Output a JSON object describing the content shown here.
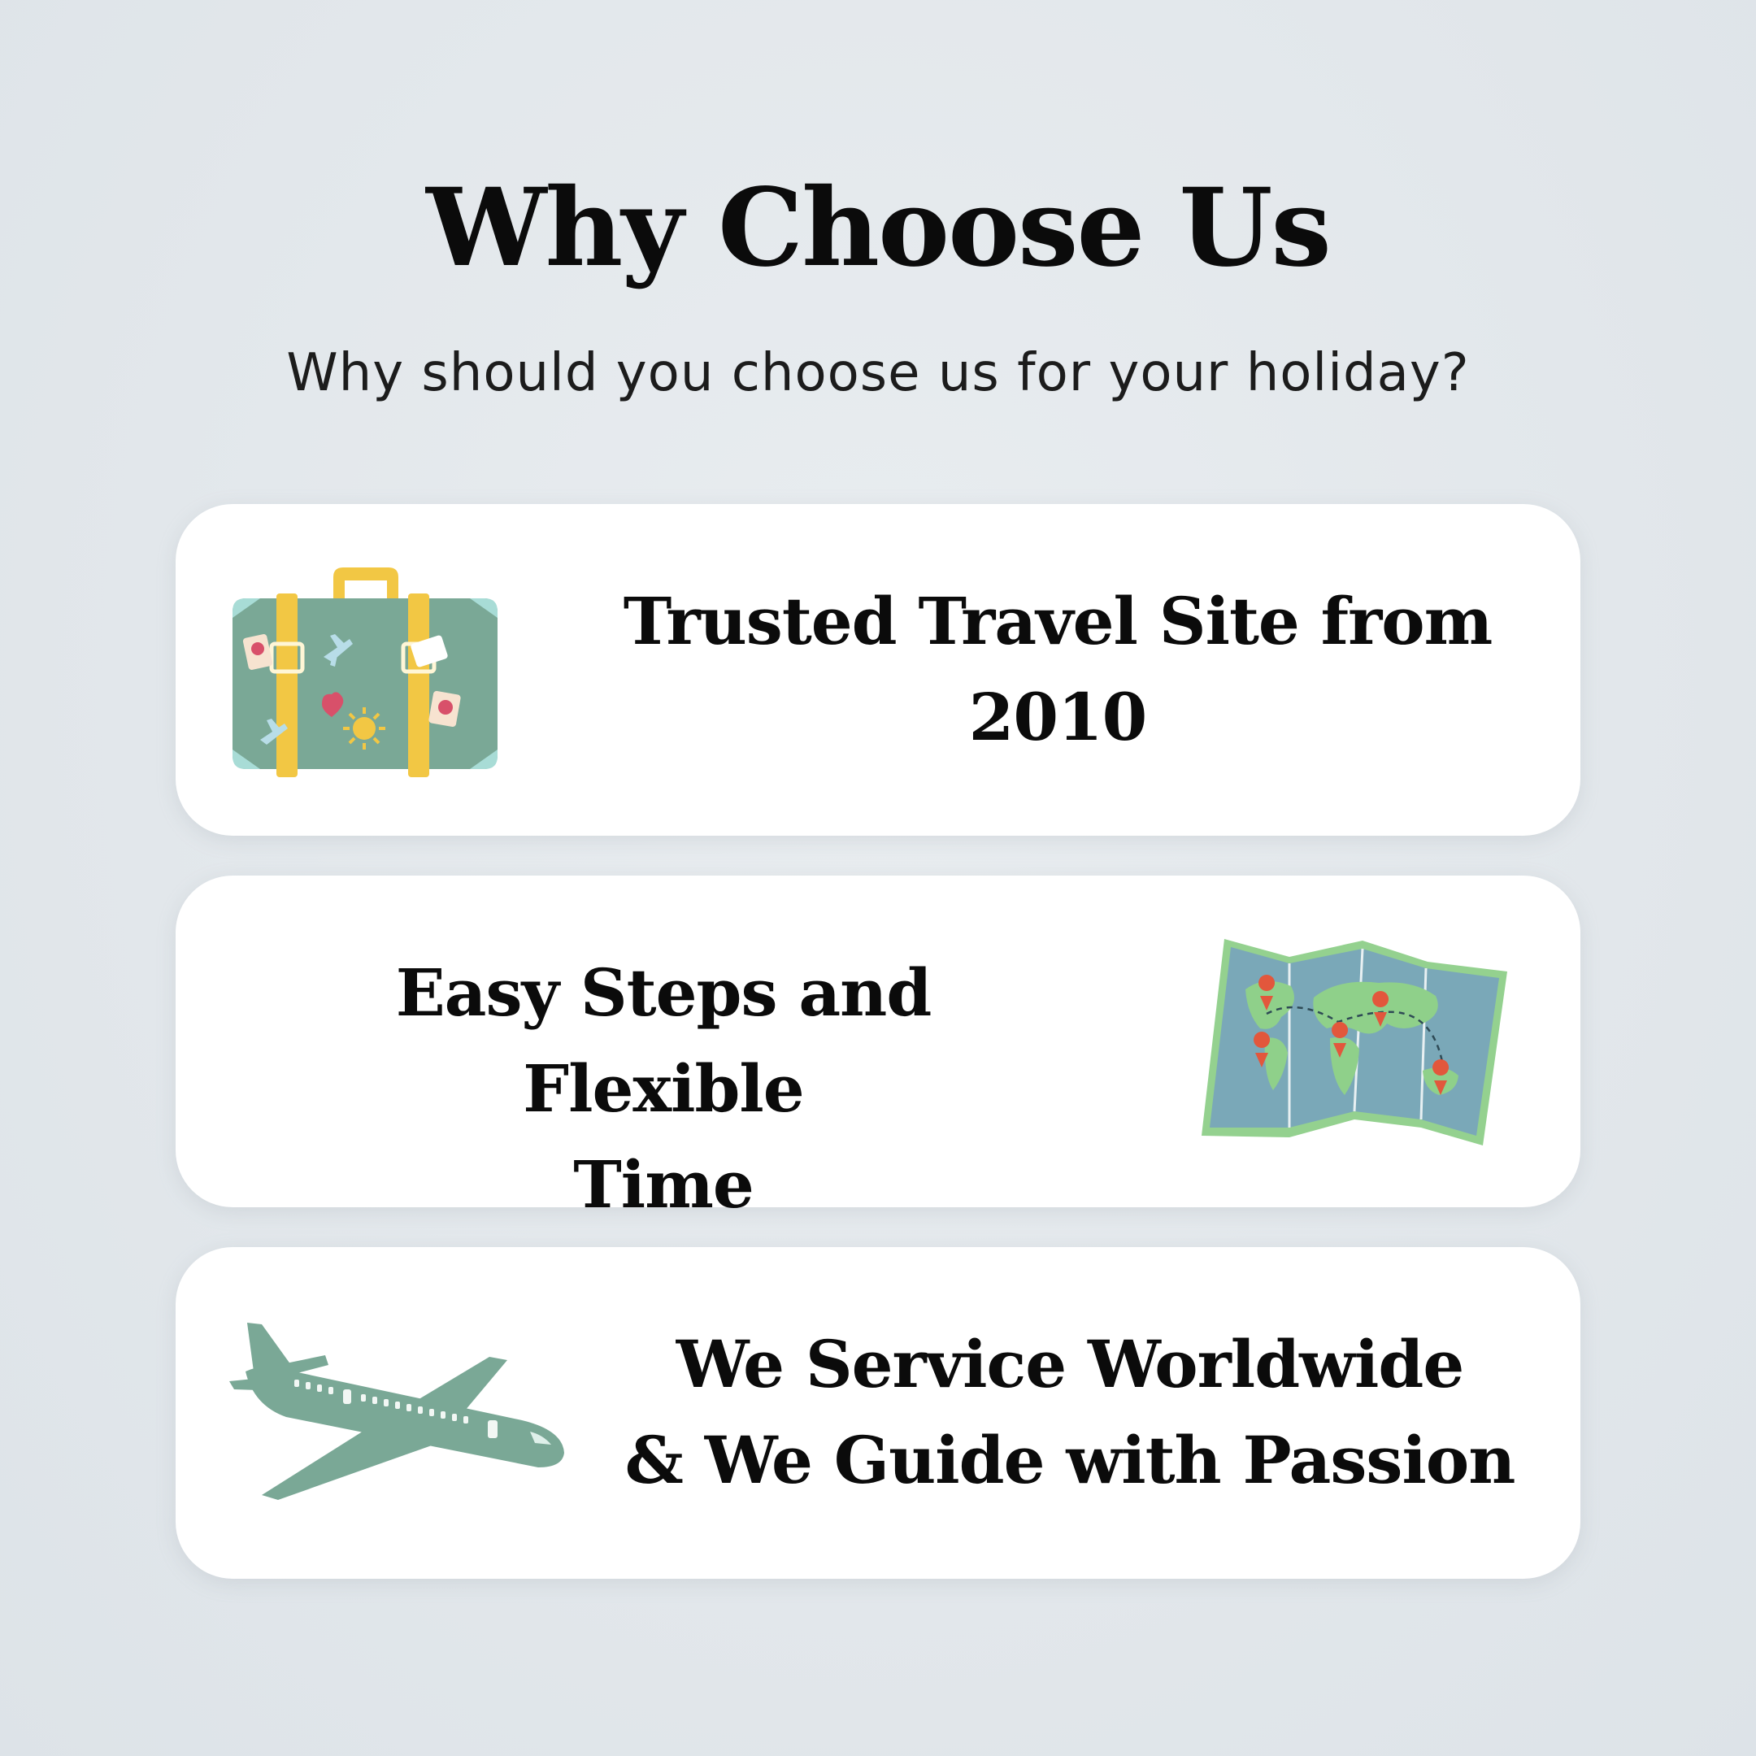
{
  "header": {
    "title": "Why Choose Us",
    "subtitle": "Why should you choose us for your holiday?"
  },
  "features": [
    {
      "line1": "Trusted Travel Site from",
      "line2": "2010",
      "icon": "suitcase-icon"
    },
    {
      "line1": "Easy Steps and Flexible",
      "line2": "Time",
      "icon": "world-map-icon"
    },
    {
      "line1": "We Service Worldwide",
      "line2": "& We Guide with Passion",
      "icon": "airplane-icon"
    }
  ],
  "colors": {
    "background": "#e3e8ec",
    "card": "#ffffff",
    "text": "#0b0b0b",
    "illustration_green": "#7aa896",
    "accent_yellow": "#f2c744"
  }
}
